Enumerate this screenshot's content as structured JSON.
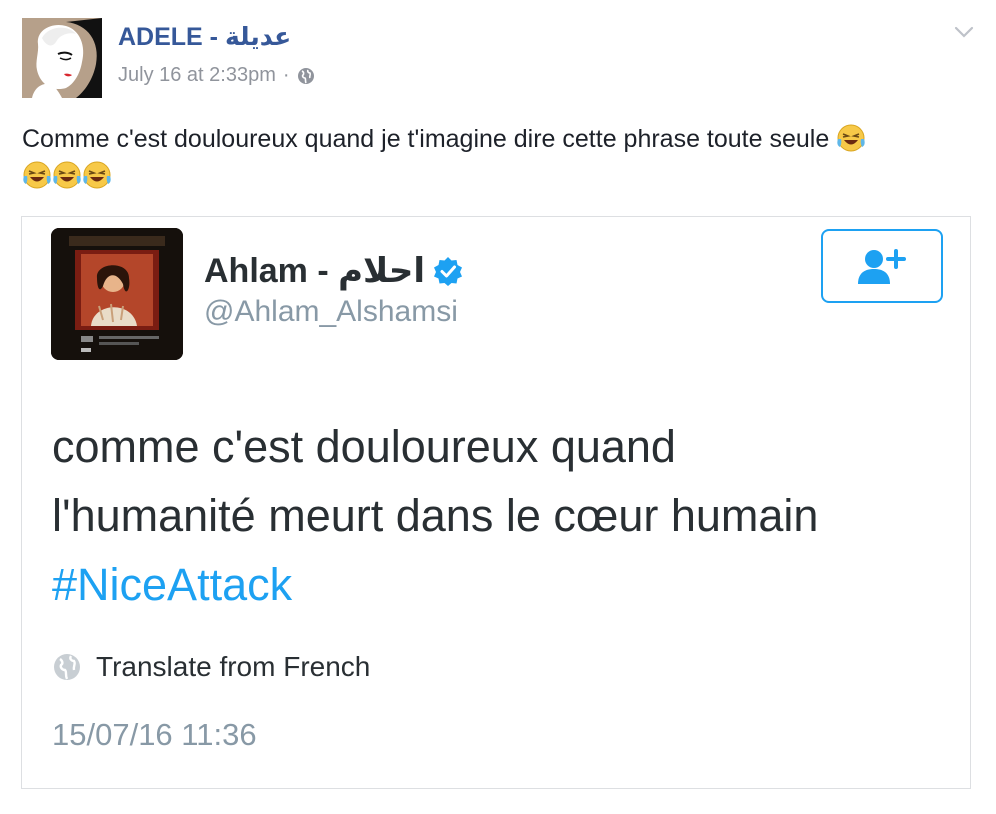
{
  "post": {
    "author": "ADELE - عديلة",
    "timestamp": "July 16 at 2:33pm",
    "separator": "·",
    "privacy_icon": "globe-icon",
    "menu_icon": "chevron-down-icon",
    "text": "Comme c'est douloureux quand je t'imagine dire cette phrase toute seule",
    "emoji": "face-with-tears-of-joy",
    "emoji_count_total": 4
  },
  "tweet": {
    "display_name": "Ahlam - احلام",
    "verified_icon": "verified-badge-icon",
    "handle": "@Ahlam_Alshamsi",
    "follow_icon": "follow-user-icon",
    "text_line1": "comme c'est douloureux quand",
    "text_line2": "l'humanité meurt dans le cœur humain",
    "hashtag": "#NiceAttack",
    "translate_label": "Translate from French",
    "datetime": "15/07/16 11:36"
  },
  "colors": {
    "facebook_link": "#365899",
    "facebook_meta": "#90949c",
    "twitter_blue": "#1da1f2",
    "twitter_gray": "#8899a6",
    "twitter_text": "#292f33"
  }
}
